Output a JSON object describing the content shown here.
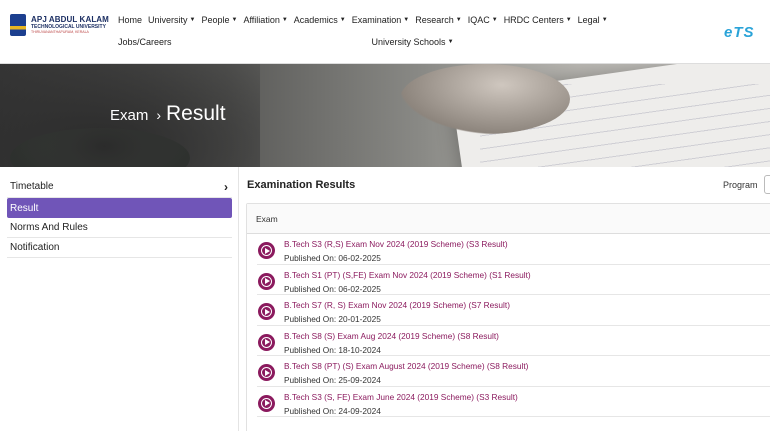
{
  "header": {
    "logo_line1": "APJ ABDUL KALAM",
    "logo_line2": "TECHNOLOGICAL UNIVERSITY",
    "logo_line3": "THIRUVANANTHAPURAM, KERALA",
    "nav": [
      {
        "label": "Home",
        "dropdown": false
      },
      {
        "label": "University",
        "dropdown": true
      },
      {
        "label": "People",
        "dropdown": true
      },
      {
        "label": "Affiliation",
        "dropdown": true
      },
      {
        "label": "Academics",
        "dropdown": true
      },
      {
        "label": "Examination",
        "dropdown": true
      },
      {
        "label": "Research",
        "dropdown": true
      },
      {
        "label": "IQAC",
        "dropdown": true
      },
      {
        "label": "HRDC Centers",
        "dropdown": true
      },
      {
        "label": "Legal",
        "dropdown": true
      },
      {
        "label": "Jobs/Careers",
        "dropdown": false
      },
      {
        "label": "University Schools",
        "dropdown": true
      }
    ],
    "right_logo": "eTS"
  },
  "banner": {
    "crumb": "Exam",
    "separator": "›",
    "title": "Result"
  },
  "sidebar": {
    "items": [
      {
        "label": "Timetable",
        "arrow": "›",
        "active": false
      },
      {
        "label": "Result",
        "active": true
      },
      {
        "label": "Norms And Rules",
        "active": false
      },
      {
        "label": "Notification",
        "active": false
      }
    ]
  },
  "main": {
    "title": "Examination Results",
    "program_label": "Program",
    "table_header": "Exam",
    "published_prefix": "Published On:",
    "results": [
      {
        "title": "B.Tech S3 (R,S) Exam Nov 2024 (2019 Scheme) (S3 Result)",
        "published": "Published On: 06-02-2025"
      },
      {
        "title": "B.Tech S1 (PT) (S,FE) Exam Nov 2024 (2019 Scheme) (S1 Result)",
        "published": "Published On: 06-02-2025"
      },
      {
        "title": "B.Tech S7 (R, S) Exam Nov 2024 (2019 Scheme) (S7 Result)",
        "published": "Published On: 20-01-2025"
      },
      {
        "title": "B.Tech S8 (S) Exam Aug 2024 (2019 Scheme) (S8 Result)",
        "published": "Published On: 18-10-2024"
      },
      {
        "title": "B.Tech S8 (PT) (S) Exam August 2024 (2019 Scheme) (S8 Result)",
        "published": "Published On: 25-09-2024"
      },
      {
        "title": "B.Tech S3 (S, FE) Exam June 2024 (2019 Scheme) (S3 Result)",
        "published": "Published On: 24-09-2024"
      }
    ]
  },
  "colors": {
    "accent": "#7055b8",
    "link": "#8b1a5e"
  }
}
